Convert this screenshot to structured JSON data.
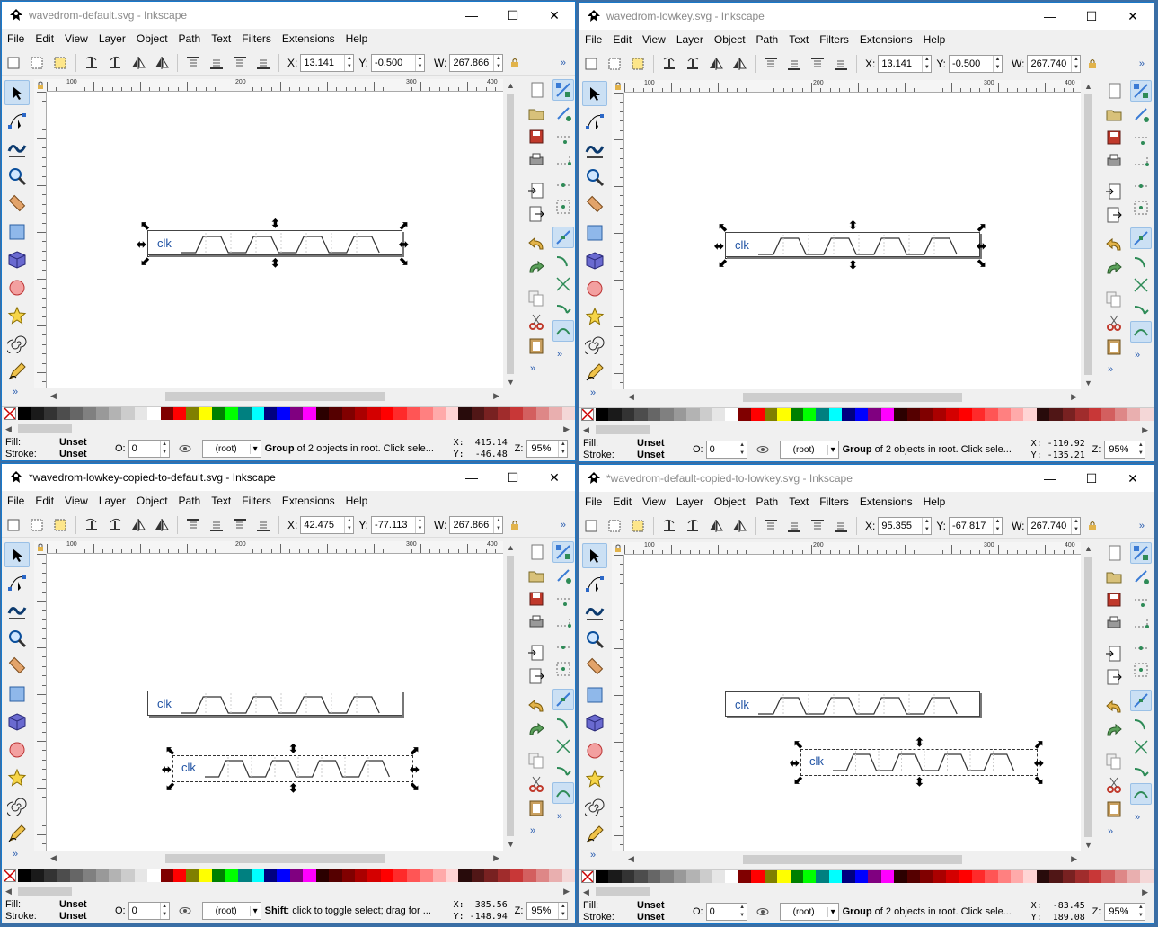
{
  "menu": [
    "File",
    "Edit",
    "View",
    "Layer",
    "Object",
    "Path",
    "Text",
    "Filters",
    "Extensions",
    "Help"
  ],
  "window_controls": {
    "minimize": "—",
    "maximize": "☐",
    "close": "✕"
  },
  "labels": {
    "x": "X:",
    "y": "Y:",
    "w": "W:",
    "fill": "Fill:",
    "stroke": "Stroke:",
    "opacity": "O:",
    "zoom": "Z:",
    "more": "»"
  },
  "palette_colors": [
    "#000000",
    "#1a1a1a",
    "#333333",
    "#4d4d4d",
    "#666666",
    "#808080",
    "#999999",
    "#b3b3b3",
    "#cccccc",
    "#e6e6e6",
    "#ffffff",
    "#800000",
    "#ff0000",
    "#808000",
    "#ffff00",
    "#008000",
    "#00ff00",
    "#008080",
    "#00ffff",
    "#000080",
    "#0000ff",
    "#800080",
    "#ff00ff",
    "#2b0000",
    "#550000",
    "#800000",
    "#aa0000",
    "#d40000",
    "#ff0000",
    "#ff2a2a",
    "#ff5555",
    "#ff8080",
    "#ffaaaa",
    "#ffd5d5",
    "#280b0b",
    "#501616",
    "#782121",
    "#a02c2c",
    "#c83737",
    "#d35f5f",
    "#de8787",
    "#e9afaf",
    "#f4d7d7"
  ],
  "windows": [
    {
      "title": "wavedrom-default.svg - Inkscape",
      "active": false,
      "x": "13.141",
      "y": "-0.500",
      "w": "267.866",
      "fill": "Unset",
      "stroke": "Unset",
      "opacity": "0",
      "layer": "(root)",
      "status_bold": "Group",
      "status_text": " of 2 objects in root. Click sele...",
      "coord_x": "X:  415.14",
      "coord_y": "Y:  -46.48",
      "zoom": "95%",
      "clk": "clk"
    },
    {
      "title": "wavedrom-lowkey.svg - Inkscape",
      "active": false,
      "x": "13.141",
      "y": "-0.500",
      "w": "267.740",
      "fill": "Unset",
      "stroke": "Unset",
      "opacity": "0",
      "layer": "(root)",
      "status_bold": "Group",
      "status_text": " of 2 objects in root. Click sele...",
      "coord_x": "X: -110.92",
      "coord_y": "Y: -135.21",
      "zoom": "95%",
      "clk": "clk"
    },
    {
      "title": "*wavedrom-lowkey-copied-to-default.svg - Inkscape",
      "active": true,
      "x": "42.475",
      "y": "-77.113",
      "w": "267.866",
      "fill": "Unset",
      "stroke": "Unset",
      "opacity": "0",
      "layer": "(root)",
      "status_bold": "Shift",
      "status_text": ": click to toggle select; drag for ...",
      "coord_x": "X:  385.56",
      "coord_y": "Y: -148.94",
      "zoom": "95%",
      "clk": "clk"
    },
    {
      "title": "*wavedrom-default-copied-to-lowkey.svg - Inkscape",
      "active": false,
      "x": "95.355",
      "y": "-67.817",
      "w": "267.740",
      "fill": "Unset",
      "stroke": "Unset",
      "opacity": "0",
      "layer": "(root)",
      "status_bold": "Group",
      "status_text": " of 2 objects in root. Click sele...",
      "coord_x": "X:  -83.45",
      "coord_y": "Y:  189.08",
      "zoom": "95%",
      "clk": "clk"
    }
  ],
  "ruler_labels": [
    "100",
    "100",
    "200",
    "300",
    "400"
  ],
  "icons": {
    "commands": [
      "new-document-icon",
      "open-icon",
      "save-icon",
      "print-icon",
      "import-icon",
      "export-icon",
      "undo-icon",
      "redo-icon",
      "copy-icon",
      "cut-icon",
      "paste-icon"
    ],
    "snap": [
      "snap-toggle-icon",
      "snap-bbox-icon",
      "snap-bbox-edge-icon",
      "snap-bbox-corner-icon",
      "snap-bbox-midpoint-icon",
      "snap-bbox-center-icon",
      "snap-nodes-icon",
      "snap-path-icon",
      "snap-intersection-icon",
      "snap-cusp-icon",
      "snap-smooth-icon"
    ]
  }
}
